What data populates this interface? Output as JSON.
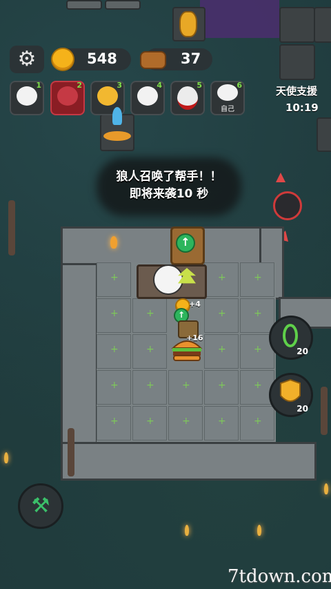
{
  "hud": {
    "gold": "548",
    "wood": "37"
  },
  "characters": [
    {
      "num": "1",
      "label": ""
    },
    {
      "num": "2",
      "label": ""
    },
    {
      "num": "3",
      "label": ""
    },
    {
      "num": "4",
      "label": ""
    },
    {
      "num": "5",
      "label": ""
    },
    {
      "num": "6",
      "label": "自己"
    }
  ],
  "support": {
    "title": "天使支援",
    "time": "10:19"
  },
  "message": {
    "line1": "狼人召唤了帮手！！",
    "line2": "即将来袭10 秒"
  },
  "gains": {
    "coin_gain": "+4",
    "food_gain": "+16"
  },
  "side_buttons": {
    "thorn_count": "20",
    "shield_count": "20"
  },
  "watermark": "7tdown.com",
  "colors": {
    "gold": "#f5b21a",
    "green_plus": "#7ec85a",
    "active_slot": "#8a1d24",
    "enemy_ring": "#d03a3a"
  }
}
